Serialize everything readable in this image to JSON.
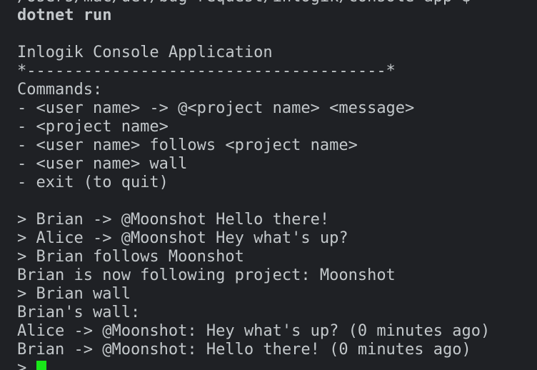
{
  "terminal": {
    "lines": [
      {
        "text": "/Users/mac/dev/bug-request/inlogik/console-app $ ",
        "bold": false
      },
      {
        "text": "dotnet run",
        "bold": true
      },
      {
        "text": "",
        "bold": false
      },
      {
        "text": "Inlogik Console Application",
        "bold": false
      },
      {
        "text": "*--------------------------------------*",
        "bold": false
      },
      {
        "text": "Commands:",
        "bold": false
      },
      {
        "text": "- <user name> -> @<project name> <message>",
        "bold": false
      },
      {
        "text": "- <project name>",
        "bold": false
      },
      {
        "text": "- <user name> follows <project name>",
        "bold": false
      },
      {
        "text": "- <user name> wall",
        "bold": false
      },
      {
        "text": "- exit (to quit)",
        "bold": false
      },
      {
        "text": "",
        "bold": false
      },
      {
        "text": "> Brian -> @Moonshot Hello there!",
        "bold": false
      },
      {
        "text": "> Alice -> @Moonshot Hey what's up?",
        "bold": false
      },
      {
        "text": "> Brian follows Moonshot",
        "bold": false
      },
      {
        "text": "Brian is now following project: Moonshot",
        "bold": false
      },
      {
        "text": "> Brian wall",
        "bold": false
      },
      {
        "text": "Brian's wall:",
        "bold": false
      },
      {
        "text": "Alice -> @Moonshot: Hey what's up? (0 minutes ago)",
        "bold": false
      },
      {
        "text": "Brian -> @Moonshot: Hello there! (0 minutes ago)",
        "bold": false
      }
    ],
    "prompt": "> ",
    "cursor_color": "#19e619",
    "background_color": "#1f2125",
    "text_color": "#c3c8cb"
  }
}
